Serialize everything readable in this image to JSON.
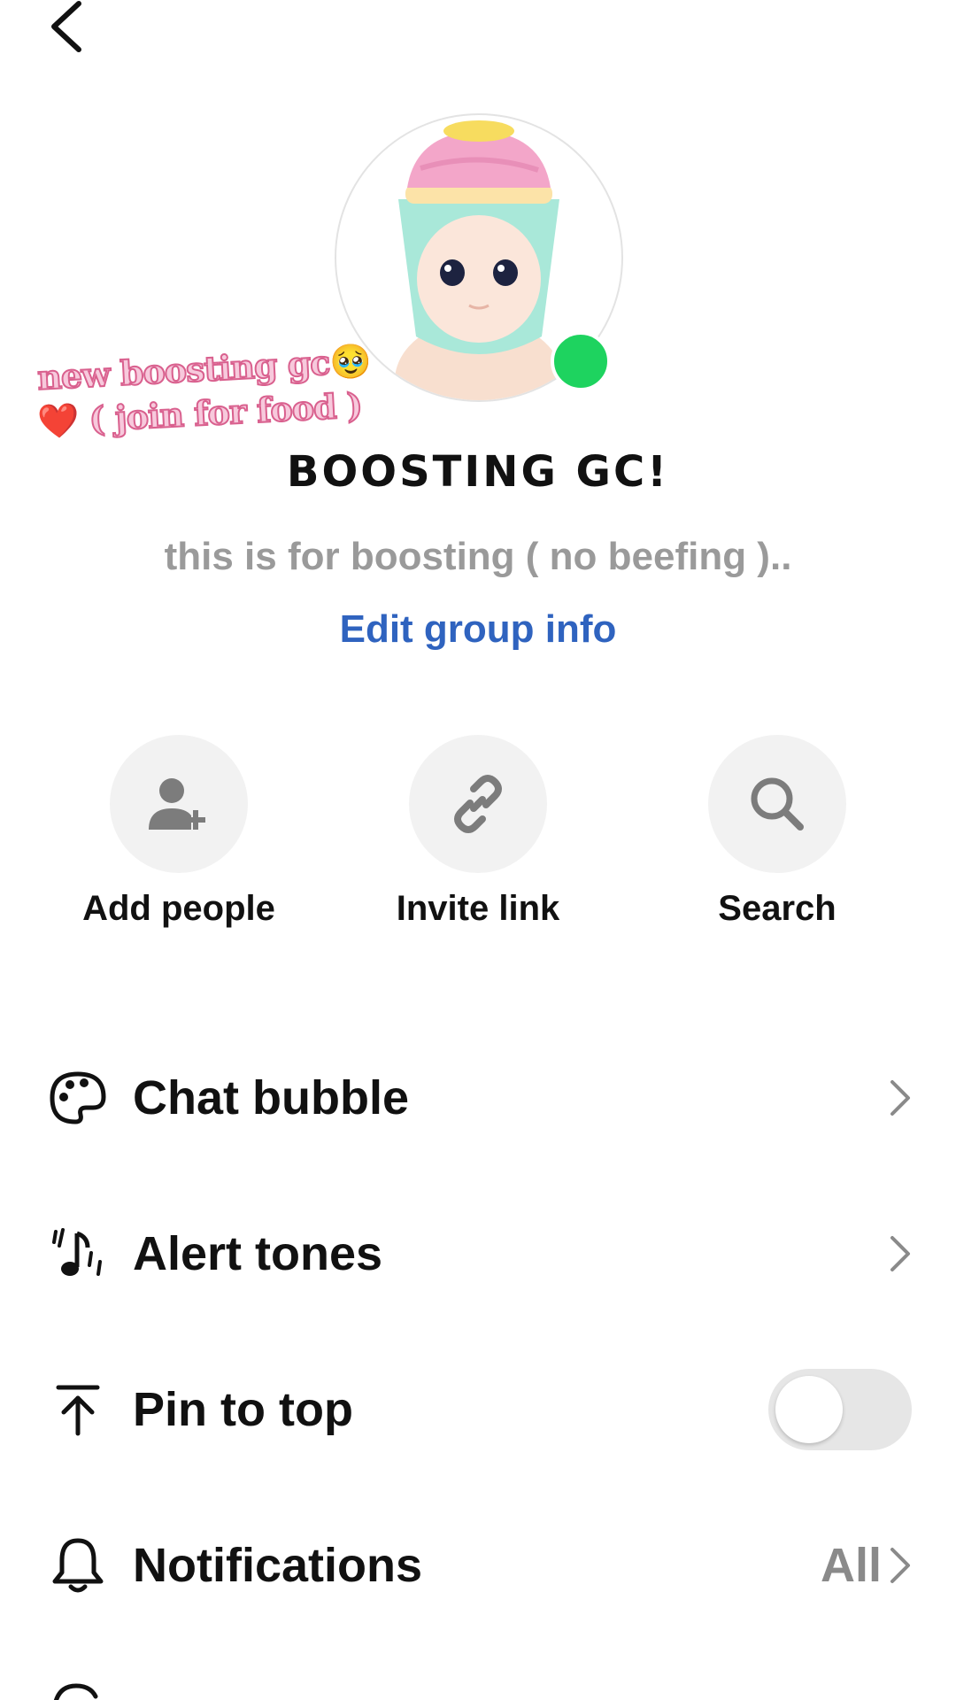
{
  "group": {
    "sticker_line1": "new boosting gc🥹",
    "sticker_line2_heart": "❤️",
    "sticker_line2_text": "( join for food )",
    "title": "BOOSTING GC!",
    "description": "this is for boosting ( no beefing )..",
    "edit_label": "Edit group info",
    "online_color": "#1ed35f"
  },
  "actions": [
    {
      "label": "Add people",
      "icon": "add-person-icon"
    },
    {
      "label": "Invite link",
      "icon": "link-icon"
    },
    {
      "label": "Search",
      "icon": "search-icon"
    }
  ],
  "settings": [
    {
      "label": "Chat bubble",
      "icon": "palette-icon"
    },
    {
      "label": "Alert tones",
      "icon": "music-note-icon"
    },
    {
      "label": "Pin to top",
      "icon": "pin-top-icon",
      "toggle": false
    },
    {
      "label": "Notifications",
      "icon": "bell-icon",
      "value": "All"
    }
  ],
  "colors": {
    "link": "#2f63bf",
    "muted": "#9a9a9a"
  }
}
